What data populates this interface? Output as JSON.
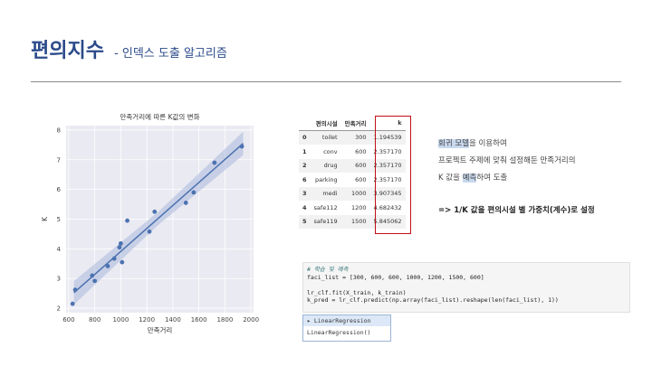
{
  "header": {
    "title": "편의지수",
    "subtitle": "-  인덱스 도출 알고리즘"
  },
  "chart_data": {
    "type": "scatter",
    "title": "만족거리에 따른 K값의 변화",
    "xlabel": "만족거리",
    "ylabel": "K",
    "xlim": [
      580,
      2020
    ],
    "ylim": [
      1.85,
      8.15
    ],
    "xticks": [
      "600",
      "800",
      "1000",
      "1200",
      "1400",
      "1600",
      "1800",
      "2000"
    ],
    "yticks": [
      "2",
      "3",
      "4",
      "5",
      "6",
      "7",
      "8"
    ],
    "points": [
      [
        630,
        2.15
      ],
      [
        650,
        2.62
      ],
      [
        780,
        3.1
      ],
      [
        800,
        2.92
      ],
      [
        900,
        3.42
      ],
      [
        950,
        3.67
      ],
      [
        990,
        4.05
      ],
      [
        1000,
        4.18
      ],
      [
        1010,
        3.55
      ],
      [
        1050,
        4.95
      ],
      [
        1220,
        4.58
      ],
      [
        1260,
        5.25
      ],
      [
        1500,
        5.55
      ],
      [
        1560,
        5.9
      ],
      [
        1720,
        6.9
      ],
      [
        1930,
        7.45
      ]
    ],
    "fit": {
      "x": [
        640,
        1940
      ],
      "y": [
        2.52,
        7.55
      ]
    },
    "grid": true,
    "colors": {
      "points": "#4c72b0",
      "line": "#4c72b0",
      "band": "#a9b8dd",
      "bg": "#eaeaf2"
    }
  },
  "table": {
    "columns": [
      "",
      "편의시설",
      "만족거리",
      "k"
    ],
    "rows": [
      [
        "0",
        "toilet",
        "300",
        "1.194539"
      ],
      [
        "1",
        "conv",
        "600",
        "2.357170"
      ],
      [
        "2",
        "drug",
        "600",
        "2.357170"
      ],
      [
        "6",
        "parking",
        "600",
        "2.357170"
      ],
      [
        "3",
        "medi",
        "1000",
        "3.907345"
      ],
      [
        "4",
        "safe112",
        "1200",
        "4.682432"
      ],
      [
        "5",
        "safe119",
        "1500",
        "5.845062"
      ]
    ]
  },
  "notes": {
    "line1_hl": "회귀 모델",
    "line1_rest": "을 이용하여",
    "line2": "프로젝트 주제에 맞춰 설정해둔 만족거리의",
    "line3_pre": "K 값을 ",
    "line3_hl": "예측",
    "line3_post": "하여 도출",
    "conclusion": "=> 1/K 값을 편의시설 별 가중치(계수)로 설정"
  },
  "code": {
    "comment": "# 학습 및 예측",
    "line1": "faci_list = [300, 600, 600, 1000, 1200, 1500, 600]",
    "line2": "lr_clf.fit(X_train, k_train)",
    "line3": "k_pred = lr_clf.predict(np.array(faci_list).reshape(len(faci_list), 1))"
  },
  "output": {
    "head": "▸ LinearRegression",
    "body": "LinearRegression()"
  }
}
